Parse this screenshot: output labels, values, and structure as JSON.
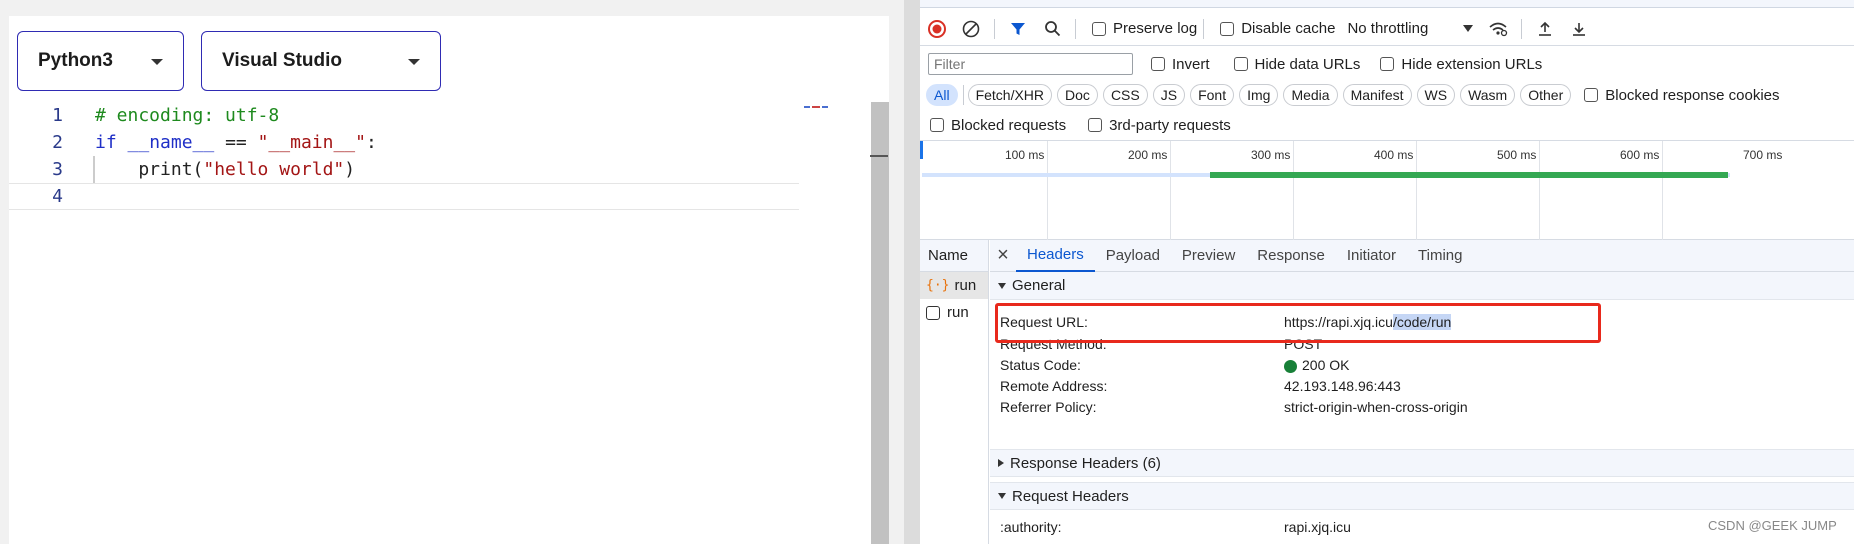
{
  "editor_app": {
    "language_select": "Python3",
    "theme_select": "Visual Studio",
    "lines": [
      {
        "num": "1",
        "text": "# encoding: utf-8"
      },
      {
        "num": "2",
        "kw": "if",
        "name": "__name__",
        "op": " == ",
        "str": "\"__main__\"",
        "tail": ":"
      },
      {
        "num": "3",
        "fn": "    print(",
        "str": "\"hello world\"",
        "tail": ")"
      },
      {
        "num": "4",
        "text": ""
      }
    ]
  },
  "devtools": {
    "toolbar": {
      "preserve_log": "Preserve log",
      "disable_cache": "Disable cache",
      "throttling": "No throttling"
    },
    "filter": {
      "placeholder": "Filter",
      "invert": "Invert",
      "hide_data_urls": "Hide data URLs",
      "hide_extension_urls": "Hide extension URLs"
    },
    "type_filters": [
      "All",
      "Fetch/XHR",
      "Doc",
      "CSS",
      "JS",
      "Font",
      "Img",
      "Media",
      "Manifest",
      "WS",
      "Wasm",
      "Other"
    ],
    "blocked_cookies": "Blocked response cookies",
    "blocked_requests": "Blocked requests",
    "third_party": "3rd-party requests",
    "timeline_ticks": [
      "100 ms",
      "200 ms",
      "300 ms",
      "400 ms",
      "500 ms",
      "600 ms",
      "700 ms"
    ],
    "request_list": {
      "header": "Name",
      "items": [
        "run",
        "run"
      ]
    },
    "detail_tabs": [
      "Headers",
      "Payload",
      "Preview",
      "Response",
      "Initiator",
      "Timing"
    ],
    "general": {
      "title": "General",
      "request_url_label": "Request URL:",
      "request_url_host": "https://rapi.xjq.icu",
      "request_url_path": "/code/run",
      "method_label": "Request Method:",
      "method_value": "POST",
      "status_label": "Status Code:",
      "status_value": "200 OK",
      "remote_label": "Remote Address:",
      "remote_value": "42.193.148.96:443",
      "referrer_label": "Referrer Policy:",
      "referrer_value": "strict-origin-when-cross-origin"
    },
    "response_headers": "Response Headers (6)",
    "request_headers": "Request Headers",
    "authority_label": ":authority:",
    "authority_value": "rapi.xjq.icu",
    "colors": {
      "accent": "#0b57d0",
      "highlight_box": "#e8291c",
      "status_ok": "#188038",
      "bar": "#34a853"
    }
  },
  "watermark": "CSDN @GEEK JUMP"
}
